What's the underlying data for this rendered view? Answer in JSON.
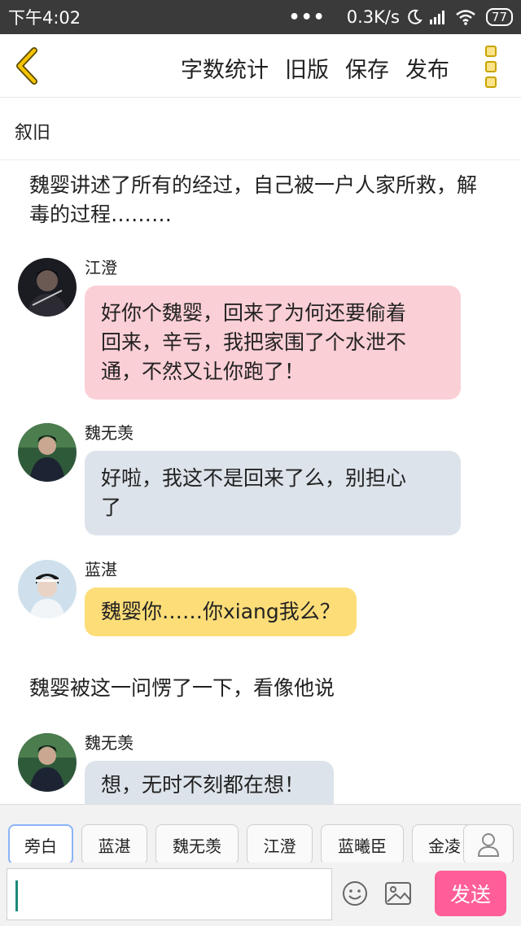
{
  "status_bar": {
    "time": "下午4:02",
    "dots": "•••",
    "network_speed": "0.3K/s",
    "battery": "77",
    "icons": [
      "moon-icon",
      "signal-icon",
      "wifi-icon",
      "battery-icon"
    ]
  },
  "toolbar": {
    "back_icon": "chevron-left-icon",
    "word_count": "字数统计",
    "old_version": "旧版",
    "save": "保存",
    "publish": "发布",
    "more_icon": "more-vertical-icon",
    "accent_color": "#c8a400"
  },
  "chapter": {
    "title": "叙旧"
  },
  "messages": [
    {
      "type": "narration",
      "text": "魏婴讲述了所有的经过，自己被一户人家所救，解毒的过程………"
    },
    {
      "type": "chat",
      "name": "江澄",
      "lines": [
        "好你个魏婴，回来了为何还要偷着",
        "回来，辛亏，我把家围了个水泄不",
        "通，不然又让你跑了！"
      ],
      "color": "#fbcfd6"
    },
    {
      "type": "chat",
      "name": "魏无羡",
      "lines": [
        "好啦，我这不是回来了么，别担心",
        "了"
      ],
      "color": "#dde3ea"
    },
    {
      "type": "chat",
      "name": "蓝湛",
      "lines": [
        "魏婴你……你xiang我么？"
      ],
      "color": "#fcdd78"
    },
    {
      "type": "narration",
      "text": "魏婴被这一问愣了一下，看像他说"
    },
    {
      "type": "chat",
      "name": "魏无羡",
      "lines": [
        "想，无时不刻都在想！"
      ],
      "color": "#dde3ea"
    }
  ],
  "characters": [
    "旁白",
    "蓝湛",
    "魏无羡",
    "江澄",
    "蓝曦臣",
    "金凌"
  ],
  "input": {
    "emoji_icon": "smiley-icon",
    "image_icon": "image-icon",
    "send_label": "发送",
    "send_color": "#ff5e98"
  }
}
